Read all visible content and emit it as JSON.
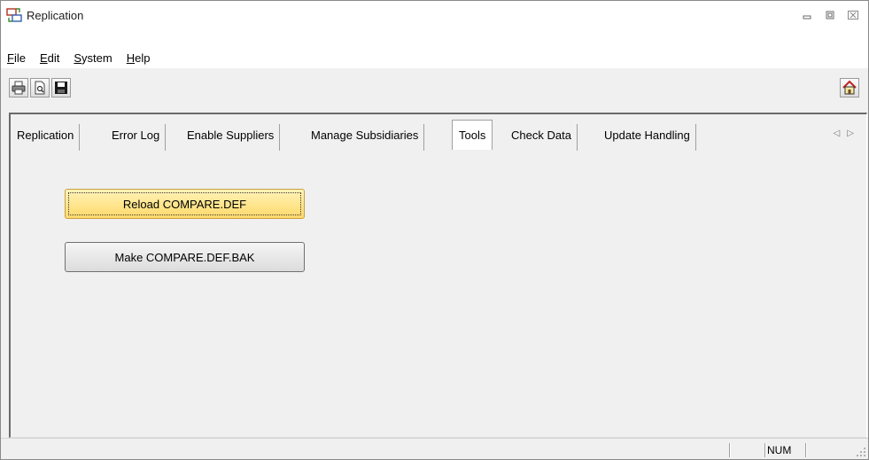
{
  "window": {
    "title": "Replication",
    "app_icon": "replication-icon",
    "controls": {
      "minimize": "minimize-icon",
      "maximize": "maximize-icon",
      "close": "close-icon"
    }
  },
  "menu": {
    "items": [
      {
        "label": "File",
        "mnemonic": "F",
        "rest": "ile"
      },
      {
        "label": "Edit",
        "mnemonic": "E",
        "rest": "dit"
      },
      {
        "label": "System",
        "mnemonic": "S",
        "rest": "ystem"
      },
      {
        "label": "Help",
        "mnemonic": "H",
        "rest": "elp"
      }
    ]
  },
  "toolbar": {
    "buttons": [
      "print-icon",
      "print-preview-icon",
      "save-icon"
    ],
    "home": "home-icon"
  },
  "tabs": {
    "items": [
      "Replication",
      "Error Log",
      "Enable Suppliers",
      "Manage Subsidiaries",
      "Tools",
      "Check Data",
      "Update Handling"
    ],
    "active": "Tools",
    "scroll_left": "◁",
    "scroll_right": "▷"
  },
  "tools": {
    "reload_button": "Reload COMPARE.DEF",
    "make_bak_button": "Make COMPARE.DEF.BAK"
  },
  "status": {
    "num": "NUM"
  },
  "colors": {
    "focused_button": "#ffd96a",
    "window_bg": "#f0f0f0"
  }
}
